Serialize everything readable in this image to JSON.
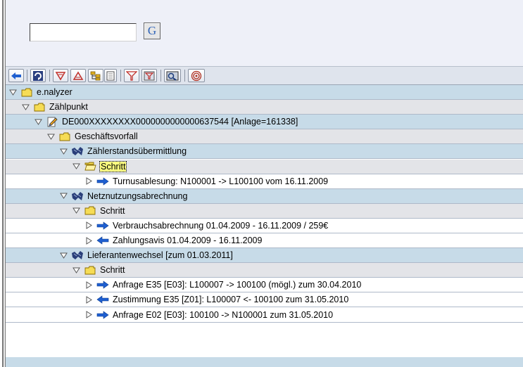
{
  "search": {
    "value": "",
    "go_label": "G"
  },
  "toolbar": {
    "buttons": [
      "back",
      "refresh",
      "expand-all",
      "collapse-all",
      "structure",
      "details",
      "filter",
      "filter-settings",
      "find",
      "spiral"
    ]
  },
  "tree": {
    "rows": [
      {
        "label": "e.nalyzer",
        "icon": "folder-icon",
        "level": 0,
        "band": "blue"
      },
      {
        "label": "Zählpunkt",
        "icon": "folder-icon",
        "level": 1,
        "band": "grey"
      },
      {
        "label": "DE000XXXXXXXX0000000000000637544 [Anlage=161338]",
        "icon": "edit-document-icon",
        "level": 2,
        "band": "blue"
      },
      {
        "label": "Geschäftsvorfall",
        "icon": "folder-icon",
        "level": 3,
        "band": "grey"
      },
      {
        "label": "Zählerstandsübermittlung",
        "icon": "process-icon",
        "level": 4,
        "band": "blue"
      },
      {
        "label": "Schritt",
        "icon": "open-folder-icon",
        "level": 5,
        "band": "grey",
        "selected": true
      },
      {
        "label": "Turnusablesung: N100001 -> L100100 vom 16.11.2009",
        "icon": "arrow-right-icon",
        "level": 6,
        "band": "white"
      },
      {
        "label": "Netznutzungsabrechnung",
        "icon": "process-icon",
        "level": 4,
        "band": "blue"
      },
      {
        "label": "Schritt",
        "icon": "folder-icon",
        "level": 5,
        "band": "grey"
      },
      {
        "label": "Verbrauchsabrechnung 01.04.2009 - 16.11.2009 / 259€",
        "icon": "arrow-right-icon",
        "level": 6,
        "band": "white"
      },
      {
        "label": "Zahlungsavis 01.04.2009 - 16.11.2009",
        "icon": "arrow-left-icon",
        "level": 6,
        "band": "white"
      },
      {
        "label": "Lieferantenwechsel [zum 01.03.2011]",
        "icon": "process-icon",
        "level": 4,
        "band": "blue"
      },
      {
        "label": "Schritt",
        "icon": "folder-icon",
        "level": 5,
        "band": "grey"
      },
      {
        "label": "Anfrage E35 [E03]: L100007 -> 100100 (mögl.) zum 30.04.2010",
        "icon": "arrow-right-icon",
        "level": 6,
        "band": "white"
      },
      {
        "label": "Zustimmung E35 [Z01]: L100007 <- 100100 zum 31.05.2010",
        "icon": "arrow-left-icon",
        "level": 6,
        "band": "white"
      },
      {
        "label": "Anfrage E02 [E03]: 100100 -> N100001 zum 31.05.2010",
        "icon": "arrow-right-icon",
        "level": 6,
        "band": "white"
      }
    ]
  },
  "colors": {
    "row_blue": "#c7dbe8",
    "row_grey": "#e3e4e8",
    "arrow": "#1f5fd0",
    "folder": "#f3d23a"
  }
}
